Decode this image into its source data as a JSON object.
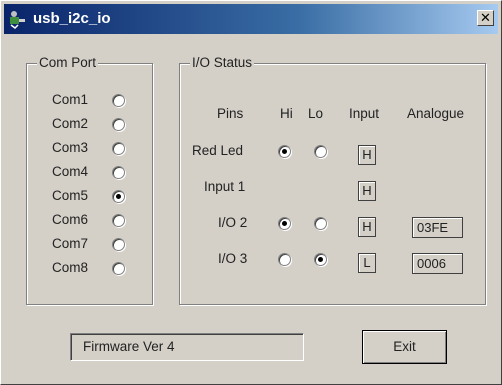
{
  "window": {
    "title": "usb_i2c_io",
    "close_glyph": "✕",
    "titlebar_colors": [
      "#0a246a",
      "#a6caf0"
    ],
    "face_color": "#d4d0c8"
  },
  "com_port": {
    "label": "Com Port",
    "ports": [
      {
        "label": "Com1",
        "selected": false
      },
      {
        "label": "Com2",
        "selected": false
      },
      {
        "label": "Com3",
        "selected": false
      },
      {
        "label": "Com4",
        "selected": false
      },
      {
        "label": "Com5",
        "selected": true
      },
      {
        "label": "Com6",
        "selected": false
      },
      {
        "label": "Com7",
        "selected": false
      },
      {
        "label": "Com8",
        "selected": false
      }
    ]
  },
  "io_status": {
    "label": "I/O Status",
    "headers": {
      "pins": "Pins",
      "hi": "Hi",
      "lo": "Lo",
      "input": "Input",
      "analogue": "Analogue"
    },
    "rows": [
      {
        "pin": "Red Led",
        "hi": true,
        "lo": false,
        "input": "H",
        "analogue": null
      },
      {
        "pin": "Input 1",
        "hi": null,
        "lo": null,
        "input": "H",
        "analogue": null
      },
      {
        "pin": "I/O 2",
        "hi": true,
        "lo": false,
        "input": "H",
        "analogue": "03FE"
      },
      {
        "pin": "I/O 3",
        "hi": false,
        "lo": true,
        "input": "L",
        "analogue": "0006"
      }
    ]
  },
  "footer": {
    "firmware": "Firmware Ver 4",
    "exit_label": "Exit"
  }
}
